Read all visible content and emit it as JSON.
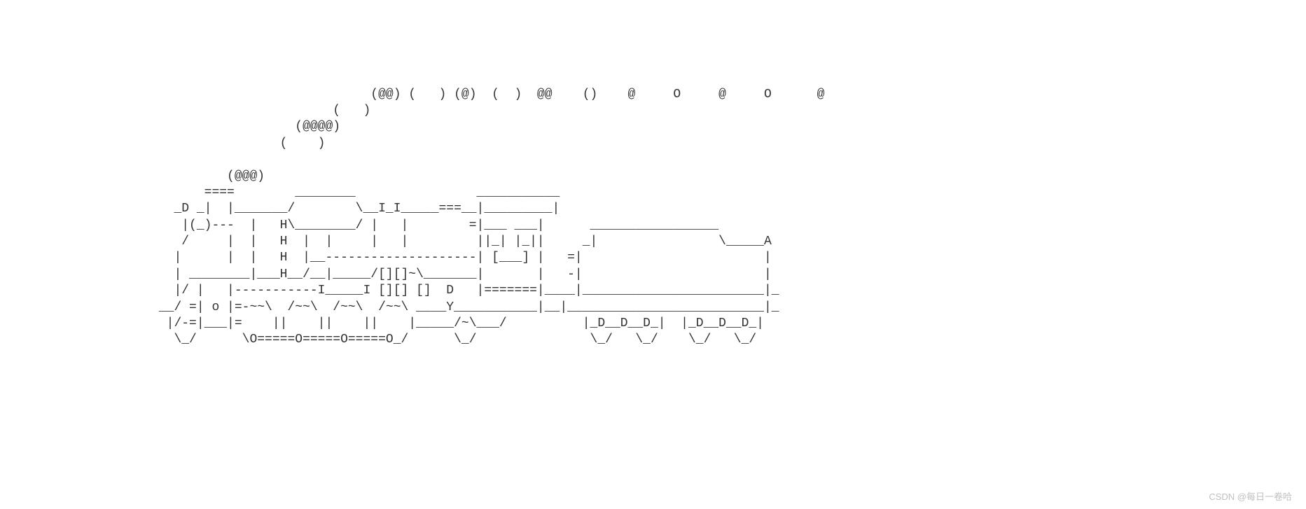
{
  "ascii_art": {
    "lines": [
      "                                                 (@@) (   ) (@)  (  )  @@    ()    @     O     @     O      @",
      "                                            (   )",
      "                                       (@@@@)",
      "                                     (    )",
      "",
      "                              (@@@)",
      "                           ====        ________                ___________",
      "                       _D _|  |_______/        \\__I_I_____===__|_________|",
      "                        |(_)---  |   H\\________/ |   |        =|___ ___|      _________________",
      "                        /     |  |   H  |  |     |   |         ||_| |_||     _|                \\_____A",
      "                       |      |  |   H  |__--------------------| [___] |   =|                        |",
      "                       | ________|___H__/__|_____/[][]~\\_______|       |   -|                        |",
      "                       |/ |   |-----------I_____I [][] []  D   |=======|____|________________________|_",
      "                     __/ =| o |=-~~\\  /~~\\  /~~\\  /~~\\ ____Y___________|__|__________________________|_",
      "                      |/-=|___|=    ||    ||    ||    |_____/~\\___/          |_D__D__D_|  |_D__D__D_|",
      "                       \\_/      \\O=====O=====O=====O_/      \\_/               \\_/   \\_/    \\_/   \\_/"
    ]
  },
  "watermark": "CSDN @每日一卷哈"
}
